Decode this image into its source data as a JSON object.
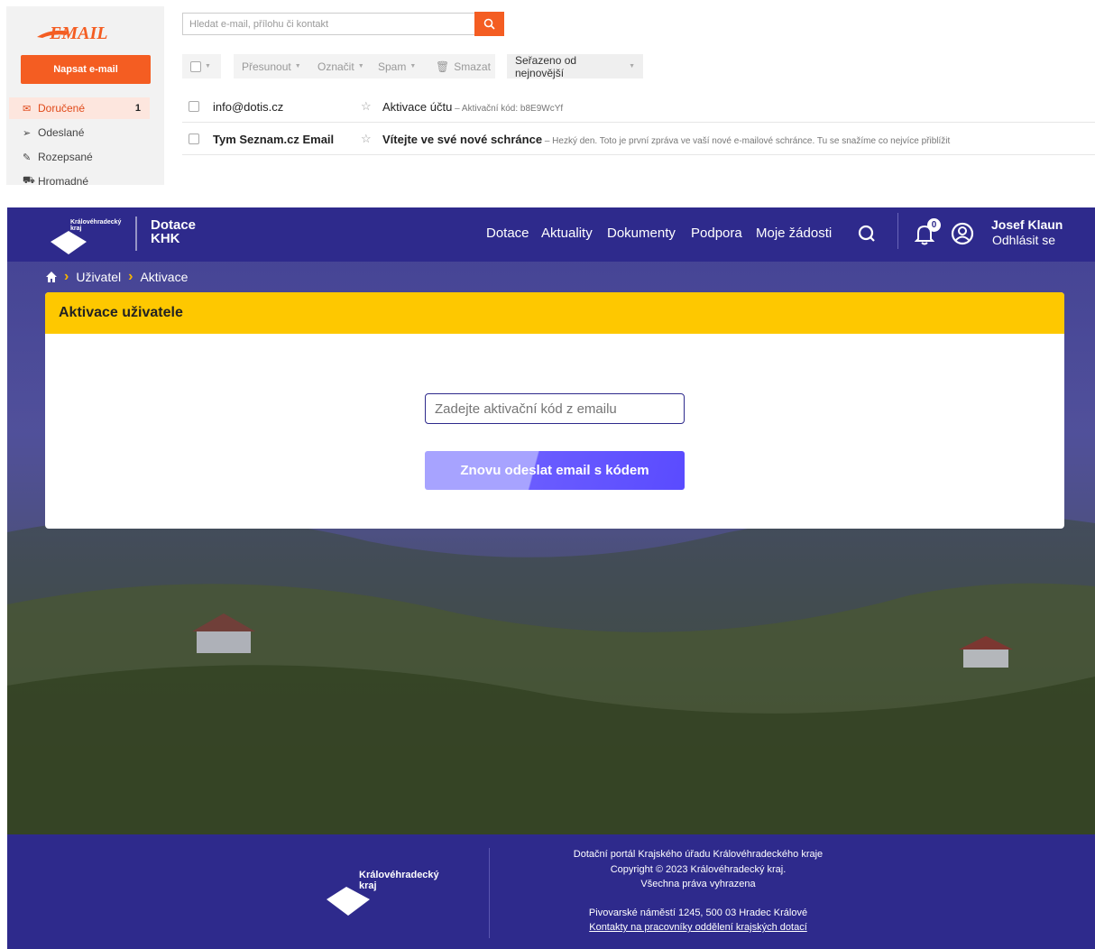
{
  "email": {
    "logo": "EMAIL",
    "compose_label": "Napsat e-mail",
    "search_placeholder": "Hledat e-mail, přílohu či kontakt",
    "folders": [
      {
        "label": "Doručené",
        "count": "1",
        "icon": "envelope-icon"
      },
      {
        "label": "Odeslané",
        "icon": "send-icon"
      },
      {
        "label": "Rozepsané",
        "icon": "draft-icon"
      },
      {
        "label": "Hromadné",
        "icon": "cart-icon"
      }
    ],
    "toolbar": {
      "move": "Přesunout",
      "mark": "Označit",
      "spam": "Spam",
      "delete": "Smazat",
      "sort": "Seřazeno od nejnovější"
    },
    "messages": [
      {
        "from": "info@dotis.cz",
        "subject": "Aktivace účtu",
        "preview": " – Aktivační kód: b8E9WcYf"
      },
      {
        "from": "Tym Seznam.cz Email",
        "subject": "Vítejte ve své nové schránce",
        "preview": " – Hezký den.   Toto je první zpráva ve vaší nové e-mailové schránce. Tu se snažíme co nejvíce přiblížit"
      }
    ]
  },
  "portal": {
    "logo_text": "Královéhradecký kraj",
    "brand_line1": "Dotace",
    "brand_line2": "KHK",
    "nav": [
      "Dotace",
      "Aktuality",
      "Dokumenty",
      "Podpora",
      "Moje žádosti"
    ],
    "notifications": "0",
    "user_name": "Josef Klaun",
    "logout": "Odhlásit se",
    "breadcrumb": [
      "Uživatel",
      "Aktivace"
    ],
    "card_title": "Aktivace uživatele",
    "code_placeholder": "Zadejte aktivační kód z emailu",
    "resend_label": "Znovu odeslat email s kódem",
    "footer": {
      "line1": "Dotační portál Krajského úřadu Královéhradeckého kraje",
      "line2": "Copyright © 2023 Královéhradecký kraj.",
      "line3": "Všechna práva vyhrazena",
      "address": "Pivovarské náměstí 1245, 500 03 Hradec Králové",
      "contacts_link": "Kontakty na pracovníky oddělení krajských dotací"
    }
  },
  "colors": {
    "email_accent": "#f45d22",
    "portal_primary": "#2e2a8c",
    "portal_yellow": "#fec800",
    "button_purple": "#5a4bff"
  }
}
